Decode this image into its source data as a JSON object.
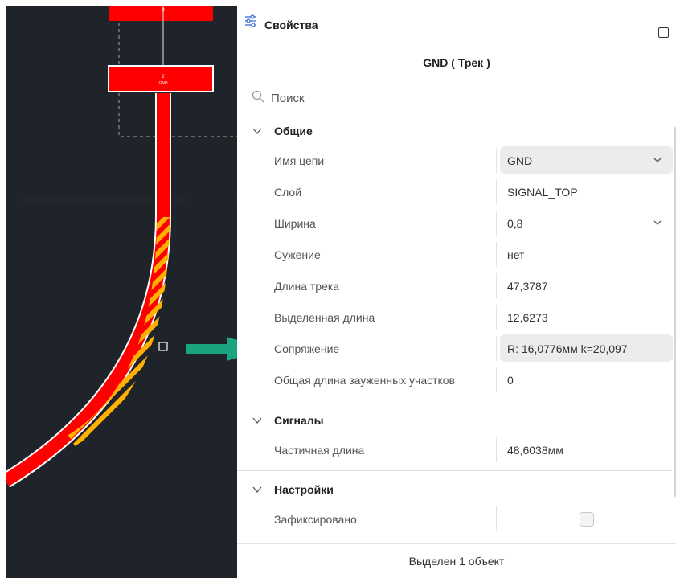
{
  "canvas": {
    "ref_top": "2",
    "ref_bottom": "2",
    "pad_net": "GND"
  },
  "panel": {
    "title": "Свойства",
    "filter_icon": "sliders-icon",
    "maximize_icon": "maximize-icon",
    "object_title": "GND ( Трек )",
    "search": {
      "placeholder": "Поиск",
      "value": ""
    },
    "groups": {
      "general": {
        "title": "Общие",
        "rows": [
          {
            "label": "Имя цепи",
            "value": "GND",
            "dropdown": true
          },
          {
            "label": "Слой",
            "value": "SIGNAL_TOP"
          },
          {
            "label": "Ширина",
            "value": "0,8",
            "dropdown": true
          },
          {
            "label": "Сужение",
            "value": "нет"
          },
          {
            "label": "Длина трека",
            "value": "47,3787"
          },
          {
            "label": "Выделенная длина",
            "value": "12,6273"
          },
          {
            "label": "Сопряжение",
            "value": "R: 16,0776мм k=20,097"
          },
          {
            "label": "Общая длина зауженных участков",
            "value": "0"
          }
        ]
      },
      "signals": {
        "title": "Сигналы",
        "rows": [
          {
            "label": "Частичная длина",
            "value": "48,6038мм"
          }
        ]
      },
      "settings": {
        "title": "Настройки",
        "rows": [
          {
            "label": "Зафиксировано",
            "checked": false
          }
        ]
      }
    },
    "footer": "Выделен 1 объект"
  },
  "colors": {
    "canvas_bg": "#1f232a",
    "track": "#ff0000",
    "selection_hatch": "#ffb000",
    "arrow": "#1aa47f"
  }
}
